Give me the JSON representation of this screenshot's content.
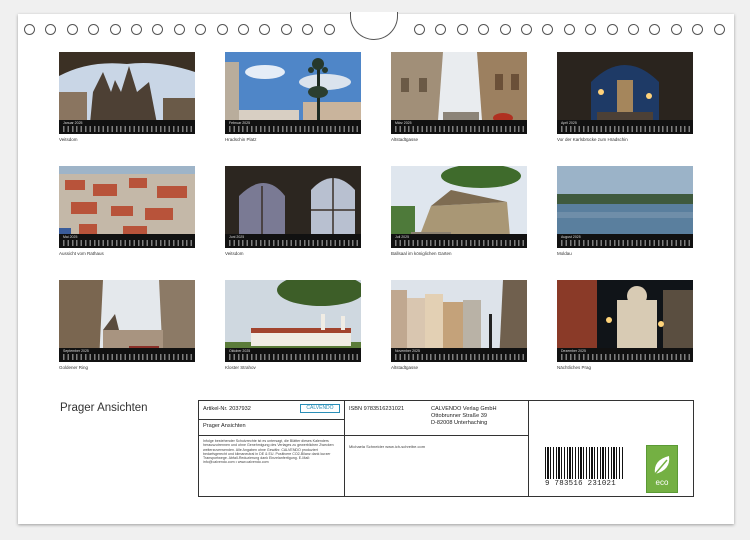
{
  "calendar": {
    "title": "Prager Ansichten",
    "months": [
      {
        "month_label": "Januar 2025",
        "caption": "Veitsdom"
      },
      {
        "month_label": "Februar 2025",
        "caption": "Hradschin Platz"
      },
      {
        "month_label": "März 2025",
        "caption": "Altstadtgasse"
      },
      {
        "month_label": "April 2025",
        "caption": "Vor der Karlsbrücke zum Hradschin"
      },
      {
        "month_label": "Mai 2025",
        "caption": "Aussicht vom Rathaus"
      },
      {
        "month_label": "Juni 2025",
        "caption": "Veitsdom"
      },
      {
        "month_label": "Juli 2025",
        "caption": "Ballsaal im königlichen Garten"
      },
      {
        "month_label": "August 2025",
        "caption": "Moldau"
      },
      {
        "month_label": "September 2025",
        "caption": "Goldener Ring"
      },
      {
        "month_label": "Oktober 2025",
        "caption": "Kloster Strahov"
      },
      {
        "month_label": "November 2025",
        "caption": "Altstadtgasse"
      },
      {
        "month_label": "Dezember 2025",
        "caption": "Nächtliches Prag"
      }
    ]
  },
  "info": {
    "article_no": "Artikel-Nr. 2037932",
    "publisher_logo": "CALVENDO",
    "book_title": "Prager Ansichten",
    "legal_text": "Infolge bestehender Schutzrechte ist es untersagt, die Blätter dieses Kalenders herauszutrennen und ohne Genehmigung des Verlages zu gewerblichen Zwecken weiterzuverwenden. Alle Angaben ohne Gewähr. CALVENDO produziert bedarfsgerecht und klimaneutral in DE & EU. Positivere CO2-Bilanz dank kurzer Transportwege. Abfall-Reduzierung dank Einzelanfertigung. E-Mail: info@calvendo.com • www.calvendo.com",
    "isbn": "ISBN 9783516231021",
    "author": "Michaela Schneider www.ich-schreibe.com",
    "publisher_lines": [
      "CALVENDO Verlag GmbH",
      "Ottobrunner Straße 39",
      "D-82008 Unterhaching"
    ],
    "barcode_number": "9 783516 231021",
    "eco_label": "eco"
  }
}
